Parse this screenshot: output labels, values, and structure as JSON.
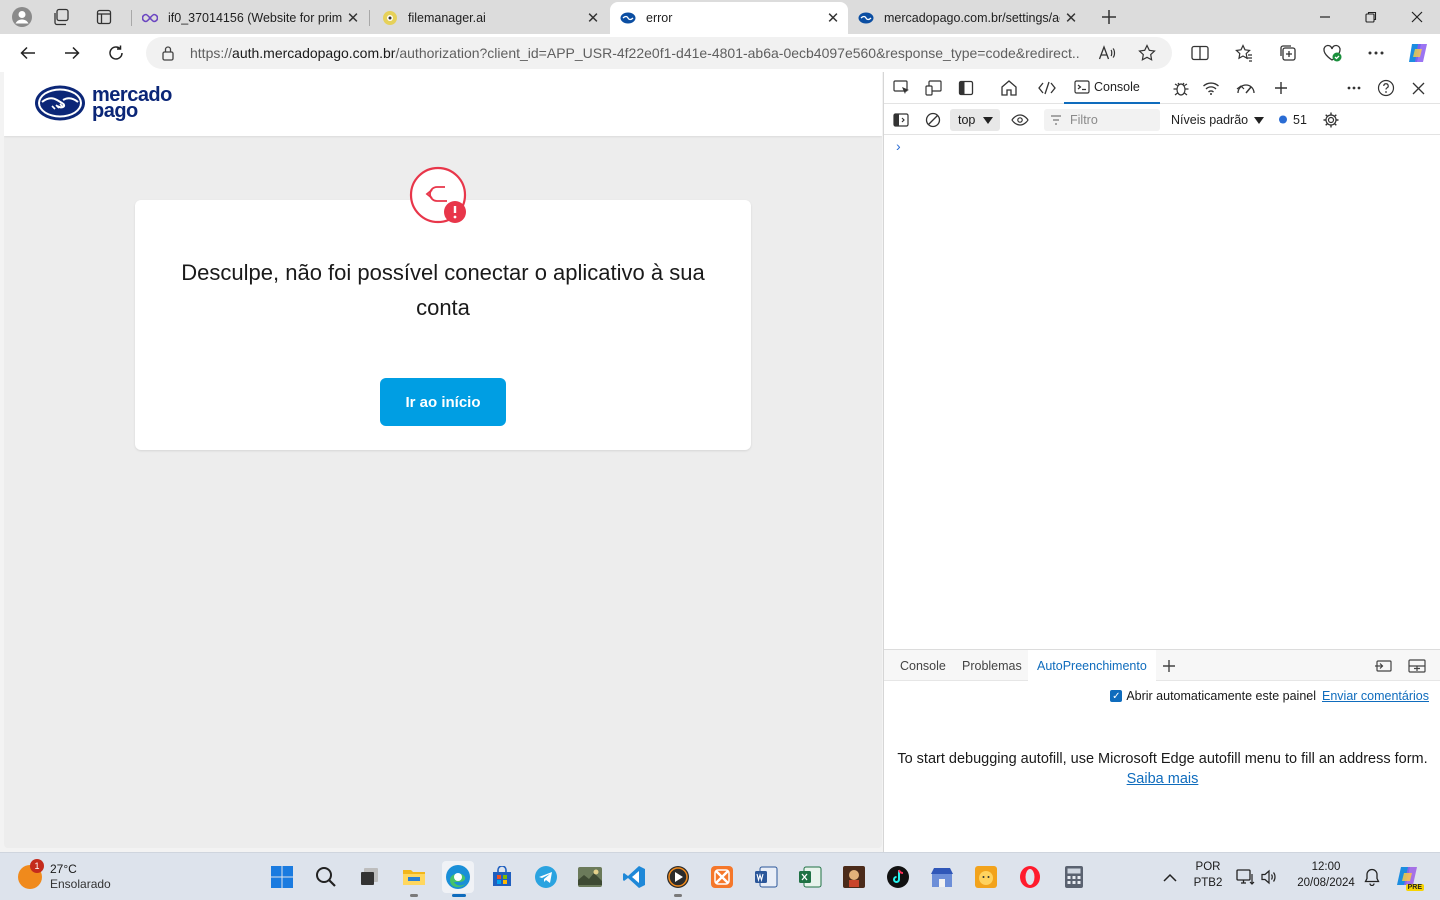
{
  "browser": {
    "tabs": [
      {
        "title": "if0_37014156 (Website for prime",
        "favicon": "infinity-icon"
      },
      {
        "title": "filemanager.ai",
        "favicon": "filemanager-icon"
      },
      {
        "title": "error",
        "favicon": "mercadopago-icon",
        "active": true
      },
      {
        "title": "mercadopago.com.br/settings/ac",
        "favicon": "mercadopago-icon"
      }
    ],
    "url_prefix": "https://",
    "url_host": "auth.mercadopago.com.br",
    "url_path": "/authorization?client_id=APP_USR-4f22e0f1-d41e-4801-ab6a-0ecb4097e560&response_type=code&redirect..."
  },
  "page": {
    "logo_line1": "mercado",
    "logo_line2": "pago",
    "error_message": "Desculpe, não foi possível conectar o aplicativo à sua conta",
    "home_button": "Ir ao início"
  },
  "devtools": {
    "console_tab": "Console",
    "context": "top",
    "filter_placeholder": "Filtro",
    "levels": "Níveis padrão",
    "issues_count": "51",
    "prompt": "›",
    "drawer_tabs": [
      "Console",
      "Problemas",
      "AutoPreenchimento"
    ],
    "auto_open_label": "Abrir automaticamente este painel",
    "feedback_link": "Enviar comentários",
    "autofill_message": "To start debugging autofill, use Microsoft Edge autofill menu to fill an address form.",
    "learn_more": "Saiba mais"
  },
  "taskbar": {
    "temperature": "27°C",
    "weather": "Ensolarado",
    "weather_badge": "1",
    "lang_line1": "POR",
    "lang_line2": "PTB2",
    "time": "12:00",
    "date": "20/08/2024",
    "copilot_badge": "PRE"
  },
  "colors": {
    "accent": "#0f6cbd",
    "mp_blue": "#009ee3",
    "mp_navy": "#0b2677",
    "error_red": "#e8364a"
  }
}
